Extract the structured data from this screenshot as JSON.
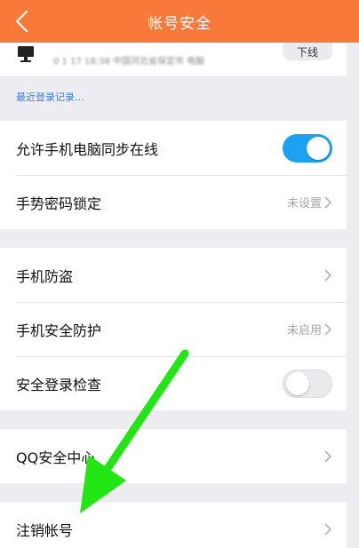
{
  "header": {
    "title": "帐号安全",
    "back_icon": "chevron-left-icon",
    "color": "#f9793a"
  },
  "device": {
    "icon": "monitor-icon",
    "info": "0 1 17 18:38 中国河北省保定市 电脑",
    "offline_label": "下线"
  },
  "login_record": {
    "label": "最近登录记录..."
  },
  "group1": {
    "sync_online": {
      "label": "允许手机电脑同步在线",
      "toggle": "on"
    },
    "gesture_lock": {
      "label": "手势密码锁定",
      "value": "未设置"
    }
  },
  "group2": {
    "anti_theft": {
      "label": "手机防盗"
    },
    "phone_security": {
      "label": "手机安全防护",
      "value": "未启用"
    },
    "login_check": {
      "label": "安全登录检查",
      "toggle": "off"
    }
  },
  "group3": {
    "qq_security": {
      "label": "QQ安全中心"
    }
  },
  "group4": {
    "cancel_account": {
      "label": "注销帐号"
    }
  },
  "colors": {
    "accent": "#f9793a",
    "toggle_on": "#1da1f2",
    "link": "#3d7bd6",
    "annotation_arrow": "#22e614"
  }
}
